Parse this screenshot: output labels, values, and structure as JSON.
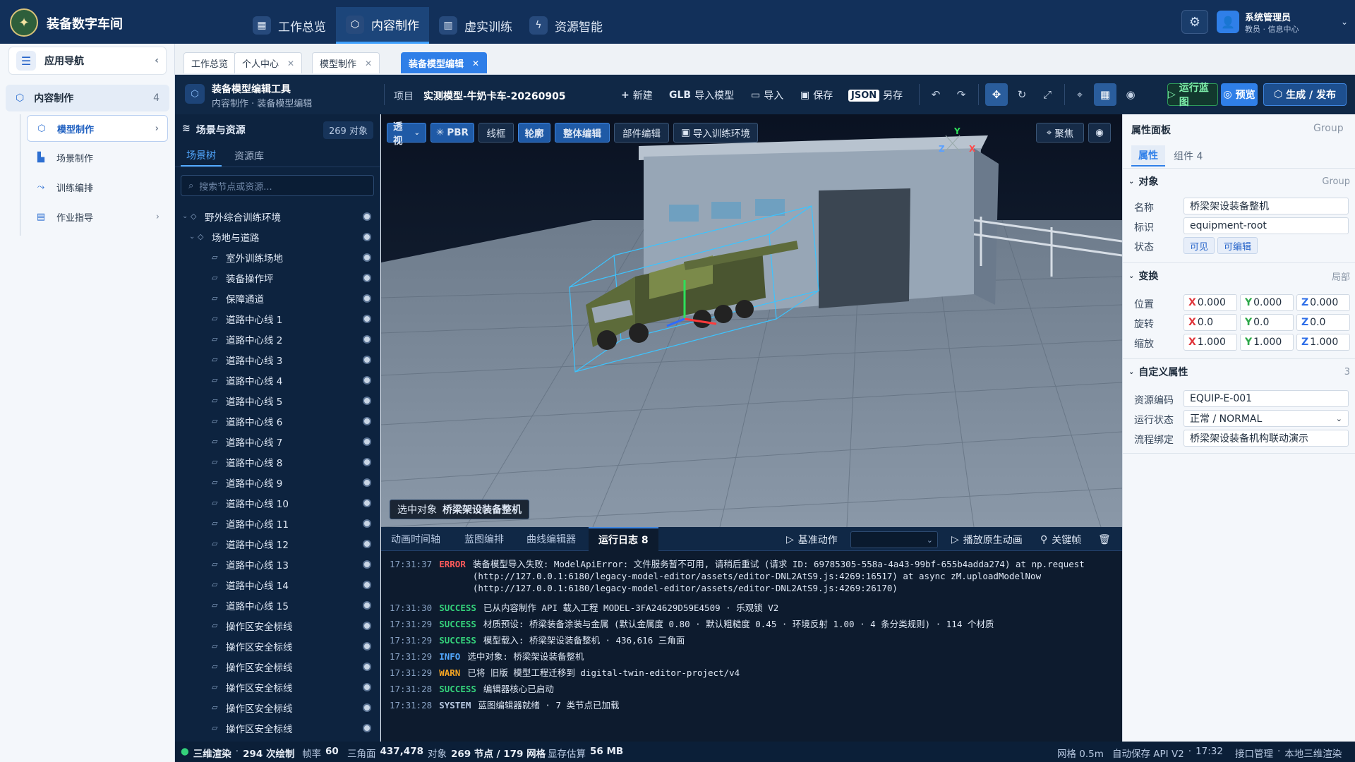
{
  "app": {
    "title": "装备数字车间",
    "logo_glyph": "✦"
  },
  "topnav": [
    {
      "label": "工作总览",
      "icon": "grid-icon",
      "glyph": "▦"
    },
    {
      "label": "内容制作",
      "icon": "cube-icon",
      "glyph": "⬡"
    },
    {
      "label": "虚实训练",
      "icon": "book-icon",
      "glyph": "▥"
    },
    {
      "label": "资源智能",
      "icon": "bolt-icon",
      "glyph": "ϟ"
    }
  ],
  "user": {
    "name": "系统管理员",
    "role": "教员 · 信息中心"
  },
  "leftnav": {
    "header": "应用导航",
    "group": {
      "label": "内容制作",
      "count": "4"
    },
    "items": [
      "模型制作",
      "场景制作",
      "训练编排",
      "作业指导"
    ]
  },
  "doc_tabs": [
    "工作总览",
    "个人中心",
    "模型制作",
    "装备模型编辑"
  ],
  "editor": {
    "tool_name": "装备模型编辑工具",
    "crumb": "内容制作 · 装备模型编辑",
    "project_label": "项目",
    "project_name": "实测模型-牛奶卡车-20260905",
    "new": "新建",
    "glb_prefix": "GLB",
    "glb_import": "导入模型",
    "import": "导入",
    "save": "保存",
    "json_badge": "JSON",
    "save_as": "另存",
    "run_blueprint": "运行蓝图",
    "preview": "预览",
    "publish": "生成 / 发布"
  },
  "scene": {
    "title": "场景与资源",
    "count": "269 对象",
    "tabs": [
      "场景树",
      "资源库"
    ],
    "search_placeholder": "搜索节点或资源...",
    "root": "野外综合训练环境",
    "sub": "场地与道路",
    "nodes": [
      "室外训练场地",
      "装备操作坪",
      "保障通道",
      "道路中心线 1",
      "道路中心线 2",
      "道路中心线 3",
      "道路中心线 4",
      "道路中心线 5",
      "道路中心线 6",
      "道路中心线 7",
      "道路中心线 8",
      "道路中心线 9",
      "道路中心线 10",
      "道路中心线 11",
      "道路中心线 12",
      "道路中心线 13",
      "道路中心线 14",
      "道路中心线 15",
      "操作区安全标线",
      "操作区安全标线",
      "操作区安全标线",
      "操作区安全标线",
      "操作区安全标线",
      "操作区安全标线"
    ]
  },
  "viewport": {
    "buttons": [
      "透视",
      "PBR",
      "线框",
      "轮廓",
      "整体编辑",
      "部件编辑",
      "导入训练环境"
    ],
    "focus": "聚焦",
    "axes": {
      "x": "X",
      "y": "Y",
      "z": "Z"
    },
    "selected_label": "选中对象",
    "selected_name": "桥梁架设装备整机"
  },
  "bottom": {
    "tabs": [
      "动画时间轴",
      "蓝图编排",
      "曲线编辑器",
      "运行日志 8"
    ],
    "base_action": "基准动作",
    "play_native": "播放原生动画",
    "keyframe": "关键帧",
    "logs": [
      {
        "time": "17:31:37",
        "level": "ERROR",
        "color": "#ff5a5a",
        "msg": "装备模型导入失败: ModelApiError: 文件服务暂不可用, 请稍后重试 (请求 ID: 69785305-558a-4a43-99bf-655b4adda274)  at np.request (http://127.0.0.1:6180/legacy-model-editor/assets/editor-DNL2AtS9.js:4269:16517) at async zM.uploadModelNow (http://127.0.0.1:6180/legacy-model-editor/assets/editor-DNL2AtS9.js:4269:26170)"
      },
      {
        "time": "17:31:30",
        "level": "SUCCESS",
        "color": "#34d27b",
        "msg": "已从内容制作 API 载入工程 MODEL-3FA24629D59E4509 · 乐观锁 V2"
      },
      {
        "time": "17:31:29",
        "level": "SUCCESS",
        "color": "#34d27b",
        "msg": "材质预设: 桥梁装备涂装与金属 (默认金属度 0.80 · 默认粗糙度 0.45 · 环境反射 1.00 · 4 条分类规则) · 114 个材质"
      },
      {
        "time": "17:31:29",
        "level": "SUCCESS",
        "color": "#34d27b",
        "msg": "模型载入: 桥梁架设装备整机 · 436,616 三角面"
      },
      {
        "time": "17:31:29",
        "level": "INFO",
        "color": "#52a8ff",
        "msg": "选中对象: 桥梁架设装备整机"
      },
      {
        "time": "17:31:29",
        "level": "WARN",
        "color": "#f5a623",
        "msg": "已将 旧版 模型工程迁移到 digital-twin-editor-project/v4"
      },
      {
        "time": "17:31:28",
        "level": "SUCCESS",
        "color": "#34d27b",
        "msg": "编辑器核心已启动"
      },
      {
        "time": "17:31:28",
        "level": "SYSTEM",
        "color": "#b8c9e2",
        "msg": "蓝图编辑器就绪 · 7 类节点已加载"
      }
    ]
  },
  "props": {
    "title": "属性面板",
    "type": "Group",
    "tabs": [
      "属性",
      "组件 4"
    ],
    "obj_section": "对象",
    "obj_type": "Group",
    "name_label": "名称",
    "name_value": "桥梁架设装备整机",
    "id_label": "标识",
    "id_value": "equipment-root",
    "state_label": "状态",
    "state_visible": "可见",
    "state_editable": "可编辑",
    "transform_section": "变换",
    "transform_mode": "局部",
    "pos_label": "位置",
    "rot_label": "旋转",
    "scale_label": "缩放",
    "pos": {
      "x": "0.000",
      "y": "0.000",
      "z": "0.000"
    },
    "rot": {
      "x": "0.0",
      "y": "0.0",
      "z": "0.0"
    },
    "scale": {
      "x": "1.000",
      "y": "1.000",
      "z": "1.000"
    },
    "custom_section": "自定义属性",
    "custom_count": "3",
    "code_label": "资源编码",
    "code_value": "EQUIP-E-001",
    "run_label": "运行状态",
    "run_value": "正常 / NORMAL",
    "flow_label": "流程绑定",
    "flow_value": "桥梁架设装备机构联动演示"
  },
  "status": {
    "render": "三维渲染",
    "draws": "294 次绘制",
    "fps_label": "帧率",
    "fps": "60",
    "tri_label": "三角面",
    "tri": "437,478",
    "obj_label": "对象",
    "obj": "269 节点 / 179 网格",
    "mem_label": "显存估算",
    "mem": "56 MB",
    "grid": "网格 0.5m",
    "autosave": "自动保存 API V2",
    "time": "17:32",
    "api": "接口管理",
    "local": "本地三维渲染"
  },
  "colors": {
    "accent": "#2f7fe8",
    "topbar": "#12305a",
    "panel_dark": "#0d233f"
  }
}
